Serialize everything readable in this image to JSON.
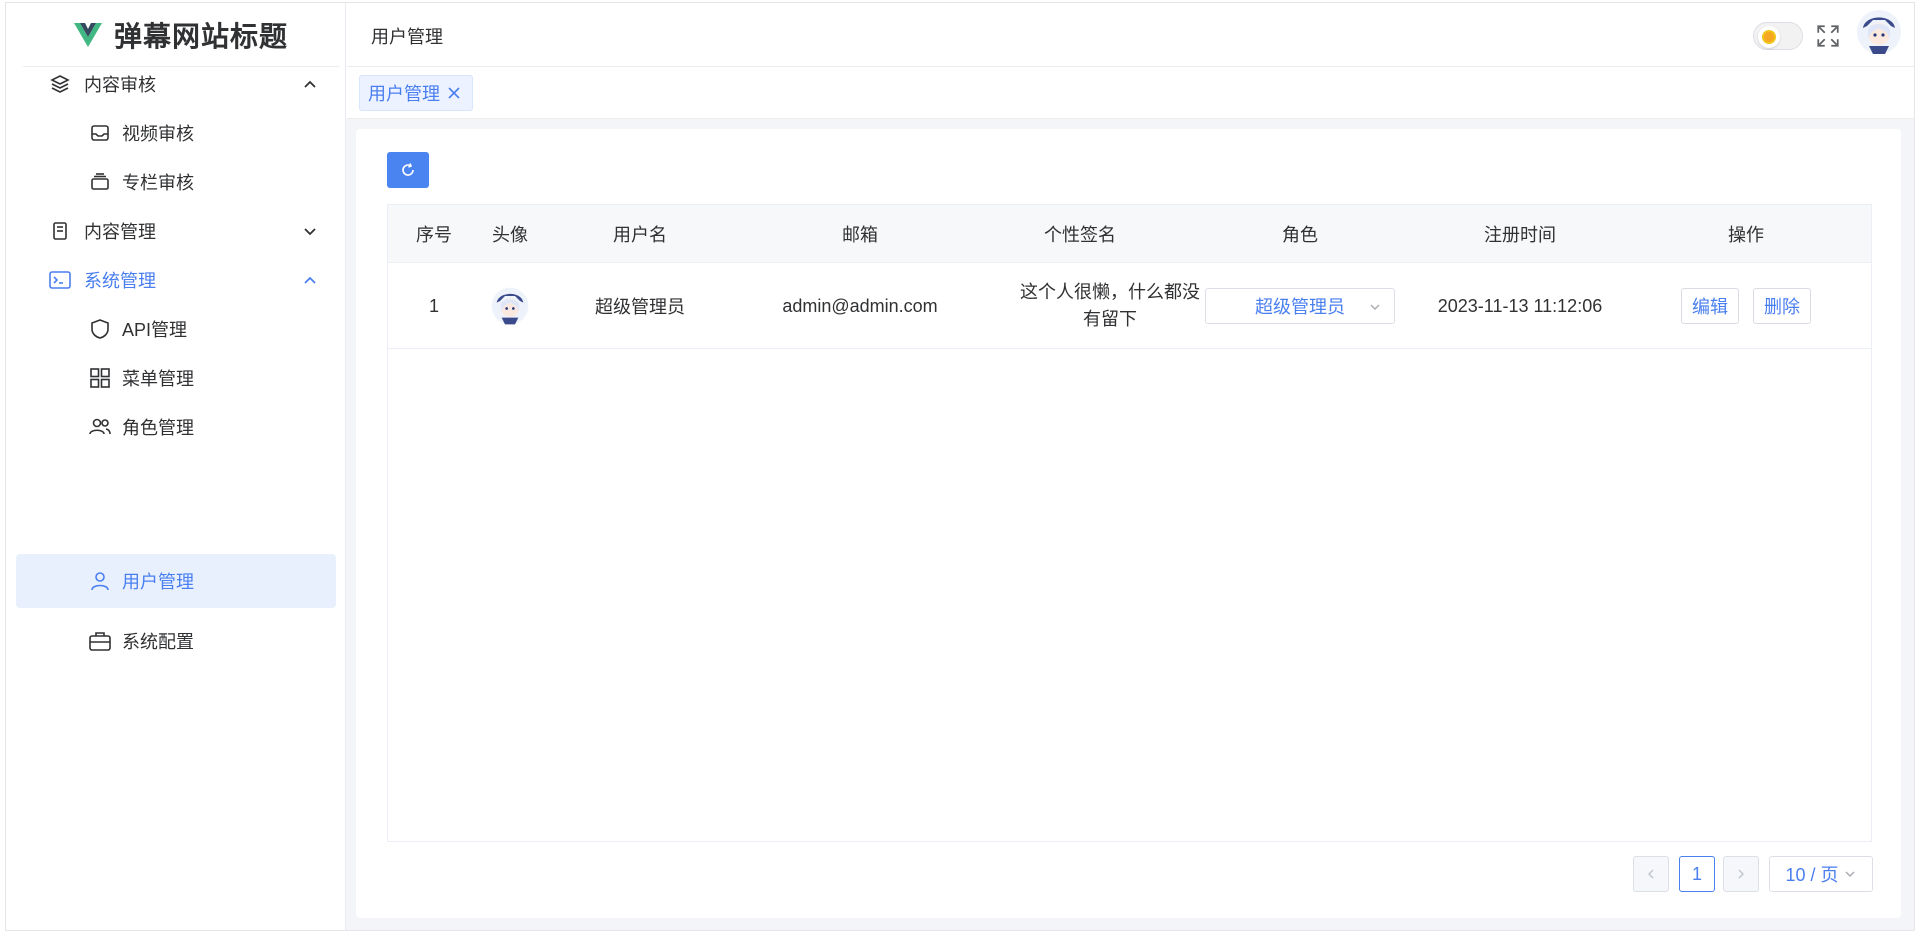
{
  "brand": {
    "title": "弹幕网站标题"
  },
  "sidebar": {
    "items": [
      {
        "label": "内容审核",
        "icon": "layers-icon",
        "level": 1,
        "expanded": true
      },
      {
        "label": "视频审核",
        "icon": "inbox-icon",
        "level": 2
      },
      {
        "label": "专栏审核",
        "icon": "cards-icon",
        "level": 2
      },
      {
        "label": "内容管理",
        "icon": "document-icon",
        "level": 1,
        "expanded": false
      },
      {
        "label": "系统管理",
        "icon": "terminal-icon",
        "level": 1,
        "expanded": true,
        "active": true
      },
      {
        "label": "API管理",
        "icon": "shield-icon",
        "level": 2
      },
      {
        "label": "菜单管理",
        "icon": "grid-icon",
        "level": 2
      },
      {
        "label": "角色管理",
        "icon": "users-icon",
        "level": 2
      },
      {
        "label": "用户管理",
        "icon": "user-icon",
        "level": 2,
        "active": true
      },
      {
        "label": "系统配置",
        "icon": "briefcase-icon",
        "level": 2
      }
    ]
  },
  "header": {
    "breadcrumb": "用户管理"
  },
  "tabs": [
    {
      "label": "用户管理"
    }
  ],
  "table": {
    "columns": [
      "序号",
      "头像",
      "用户名",
      "邮箱",
      "个性签名",
      "角色",
      "注册时间",
      "操作"
    ],
    "rows": [
      {
        "index": "1",
        "username": "超级管理员",
        "email": "admin@admin.com",
        "signature": "这个人很懒，什么都没有留下",
        "role": "超级管理员",
        "registered": "2023-11-13 11:12:06",
        "edit_label": "编辑",
        "delete_label": "删除"
      }
    ]
  },
  "pagination": {
    "current_page": "1",
    "page_size": "10 / 页"
  },
  "colors": {
    "primary": "#4a7ff0",
    "active_bg": "#e8f0fe",
    "button_blue": "#4a84f0"
  }
}
